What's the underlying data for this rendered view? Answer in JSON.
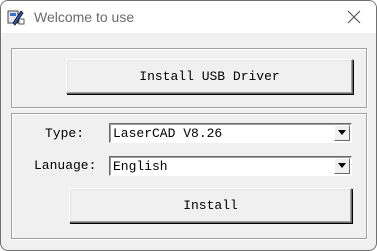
{
  "window": {
    "title": "Welcome to use"
  },
  "driver_group": {
    "install_usb_label": "Install USB Driver"
  },
  "settings_group": {
    "type_label": "Type:",
    "type_value": "LaserCAD V8.26",
    "language_label": "Lanuage:",
    "language_value": "English",
    "install_label": "Install"
  },
  "icons": {
    "app": "app-icon",
    "close": "close-icon",
    "dropdown": "chevron-down-icon"
  }
}
